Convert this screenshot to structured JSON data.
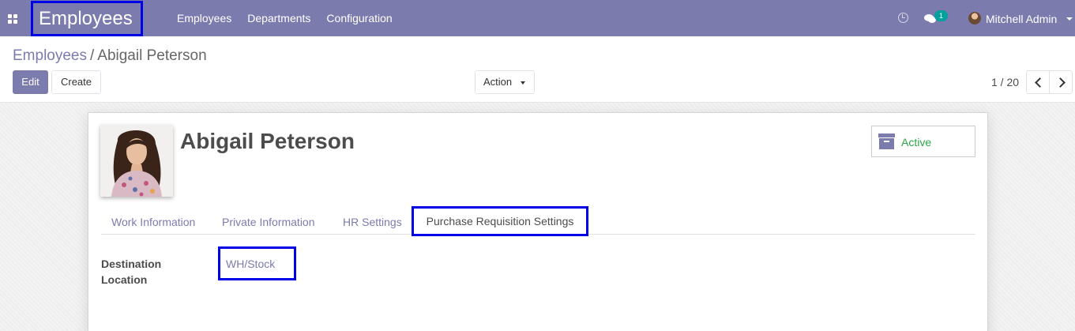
{
  "navbar": {
    "app_title": "Employees",
    "menu": [
      "Employees",
      "Departments",
      "Configuration"
    ],
    "messages_count": "1",
    "user_name": "Mitchell Admin",
    "icons": [
      "apps-grid-icon",
      "clock-icon",
      "chat-icon",
      "user-avatar",
      "caret-down-icon"
    ],
    "color": "#7c7bad"
  },
  "breadcrumb": {
    "parent": "Employees",
    "separator": "/",
    "current": "Abigail Peterson"
  },
  "buttons": {
    "edit": "Edit",
    "create": "Create",
    "action": "Action"
  },
  "pager": {
    "value": "1 / 20"
  },
  "employee": {
    "name": "Abigail Peterson",
    "status": "Active",
    "status_color": "#28a745"
  },
  "tabs": [
    {
      "label": "Work Information"
    },
    {
      "label": "Private Information"
    },
    {
      "label": "HR Settings"
    },
    {
      "label": "Purchase Requisition Settings",
      "active": true
    }
  ],
  "fields": {
    "destination_location": {
      "label": "Destination Location",
      "value": "WH/Stock"
    }
  },
  "highlight_color": "#0000e6"
}
